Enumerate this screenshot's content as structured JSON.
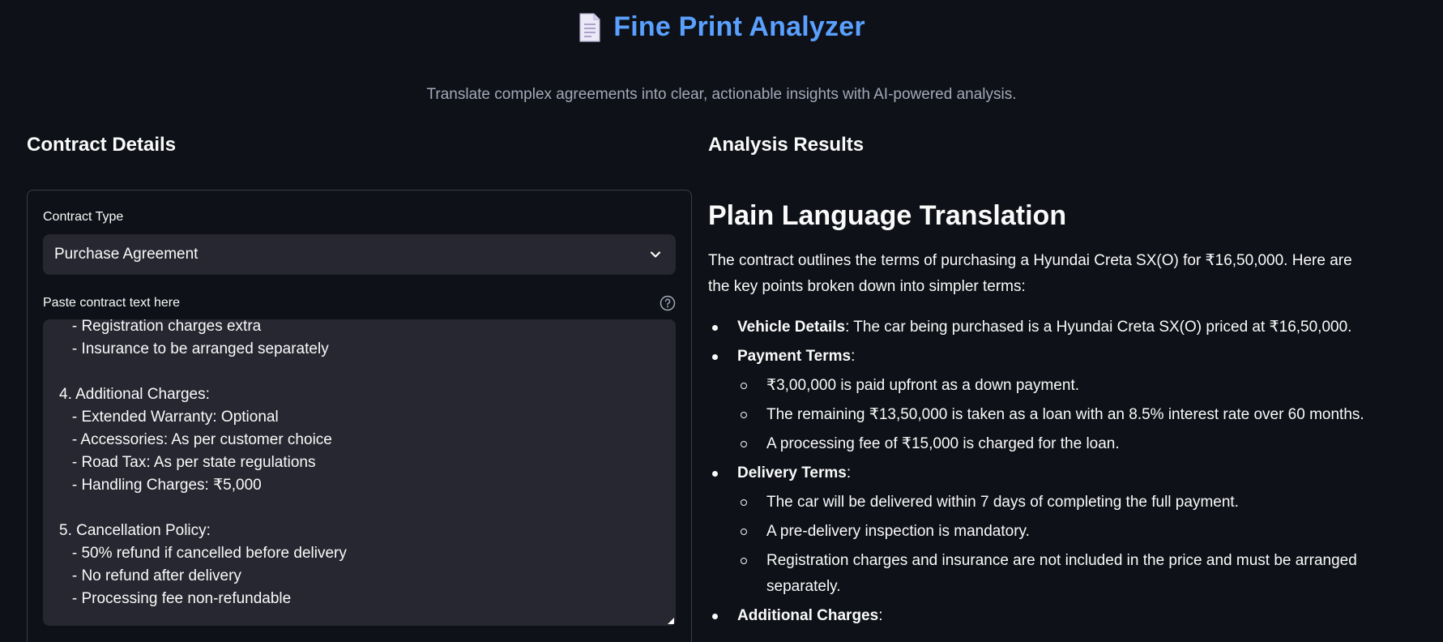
{
  "header": {
    "icon": "document-icon",
    "title": "Fine Print Analyzer",
    "subtitle": "Translate complex agreements into clear, actionable insights with AI-powered analysis."
  },
  "left": {
    "heading": "Contract Details",
    "contract_type_label": "Contract Type",
    "contract_type_value": "Purchase Agreement",
    "paste_label": "Paste contract text here",
    "text_lines": [
      "   - Registration charges extra",
      "   - Insurance to be arranged separately",
      "",
      "4. Additional Charges:",
      "   - Extended Warranty: Optional",
      "   - Accessories: As per customer choice",
      "   - Road Tax: As per state regulations",
      "   - Handling Charges: ₹5,000",
      "",
      "5. Cancellation Policy:",
      "   - 50% refund if cancelled before delivery",
      "   - No refund after delivery",
      "   - Processing fee non-refundable"
    ]
  },
  "right": {
    "heading": "Analysis Results",
    "title": "Plain Language Translation",
    "intro": "The contract outlines the terms of purchasing a Hyundai Creta SX(O) for ₹16,50,000. Here are the key points broken down into simpler terms:",
    "bullets": [
      {
        "label": "Vehicle Details",
        "text": ": The car being purchased is a Hyundai Creta SX(O) priced at ₹16,50,000.",
        "subs": []
      },
      {
        "label": "Payment Terms",
        "text": ":",
        "subs": [
          "₹3,00,000 is paid upfront as a down payment.",
          "The remaining ₹13,50,000 is taken as a loan with an 8.5% interest rate over 60 months.",
          "A processing fee of ₹15,000 is charged for the loan."
        ]
      },
      {
        "label": "Delivery Terms",
        "text": ":",
        "subs": [
          "The car will be delivered within 7 days of completing the full payment.",
          "A pre-delivery inspection is mandatory.",
          "Registration charges and insurance are not included in the price and must be arranged separately."
        ]
      },
      {
        "label": "Additional Charges",
        "text": ":",
        "subs": []
      }
    ]
  },
  "colors": {
    "background": "#0e1117",
    "accent_title": "#5aa0ff",
    "panel": "#262730"
  }
}
